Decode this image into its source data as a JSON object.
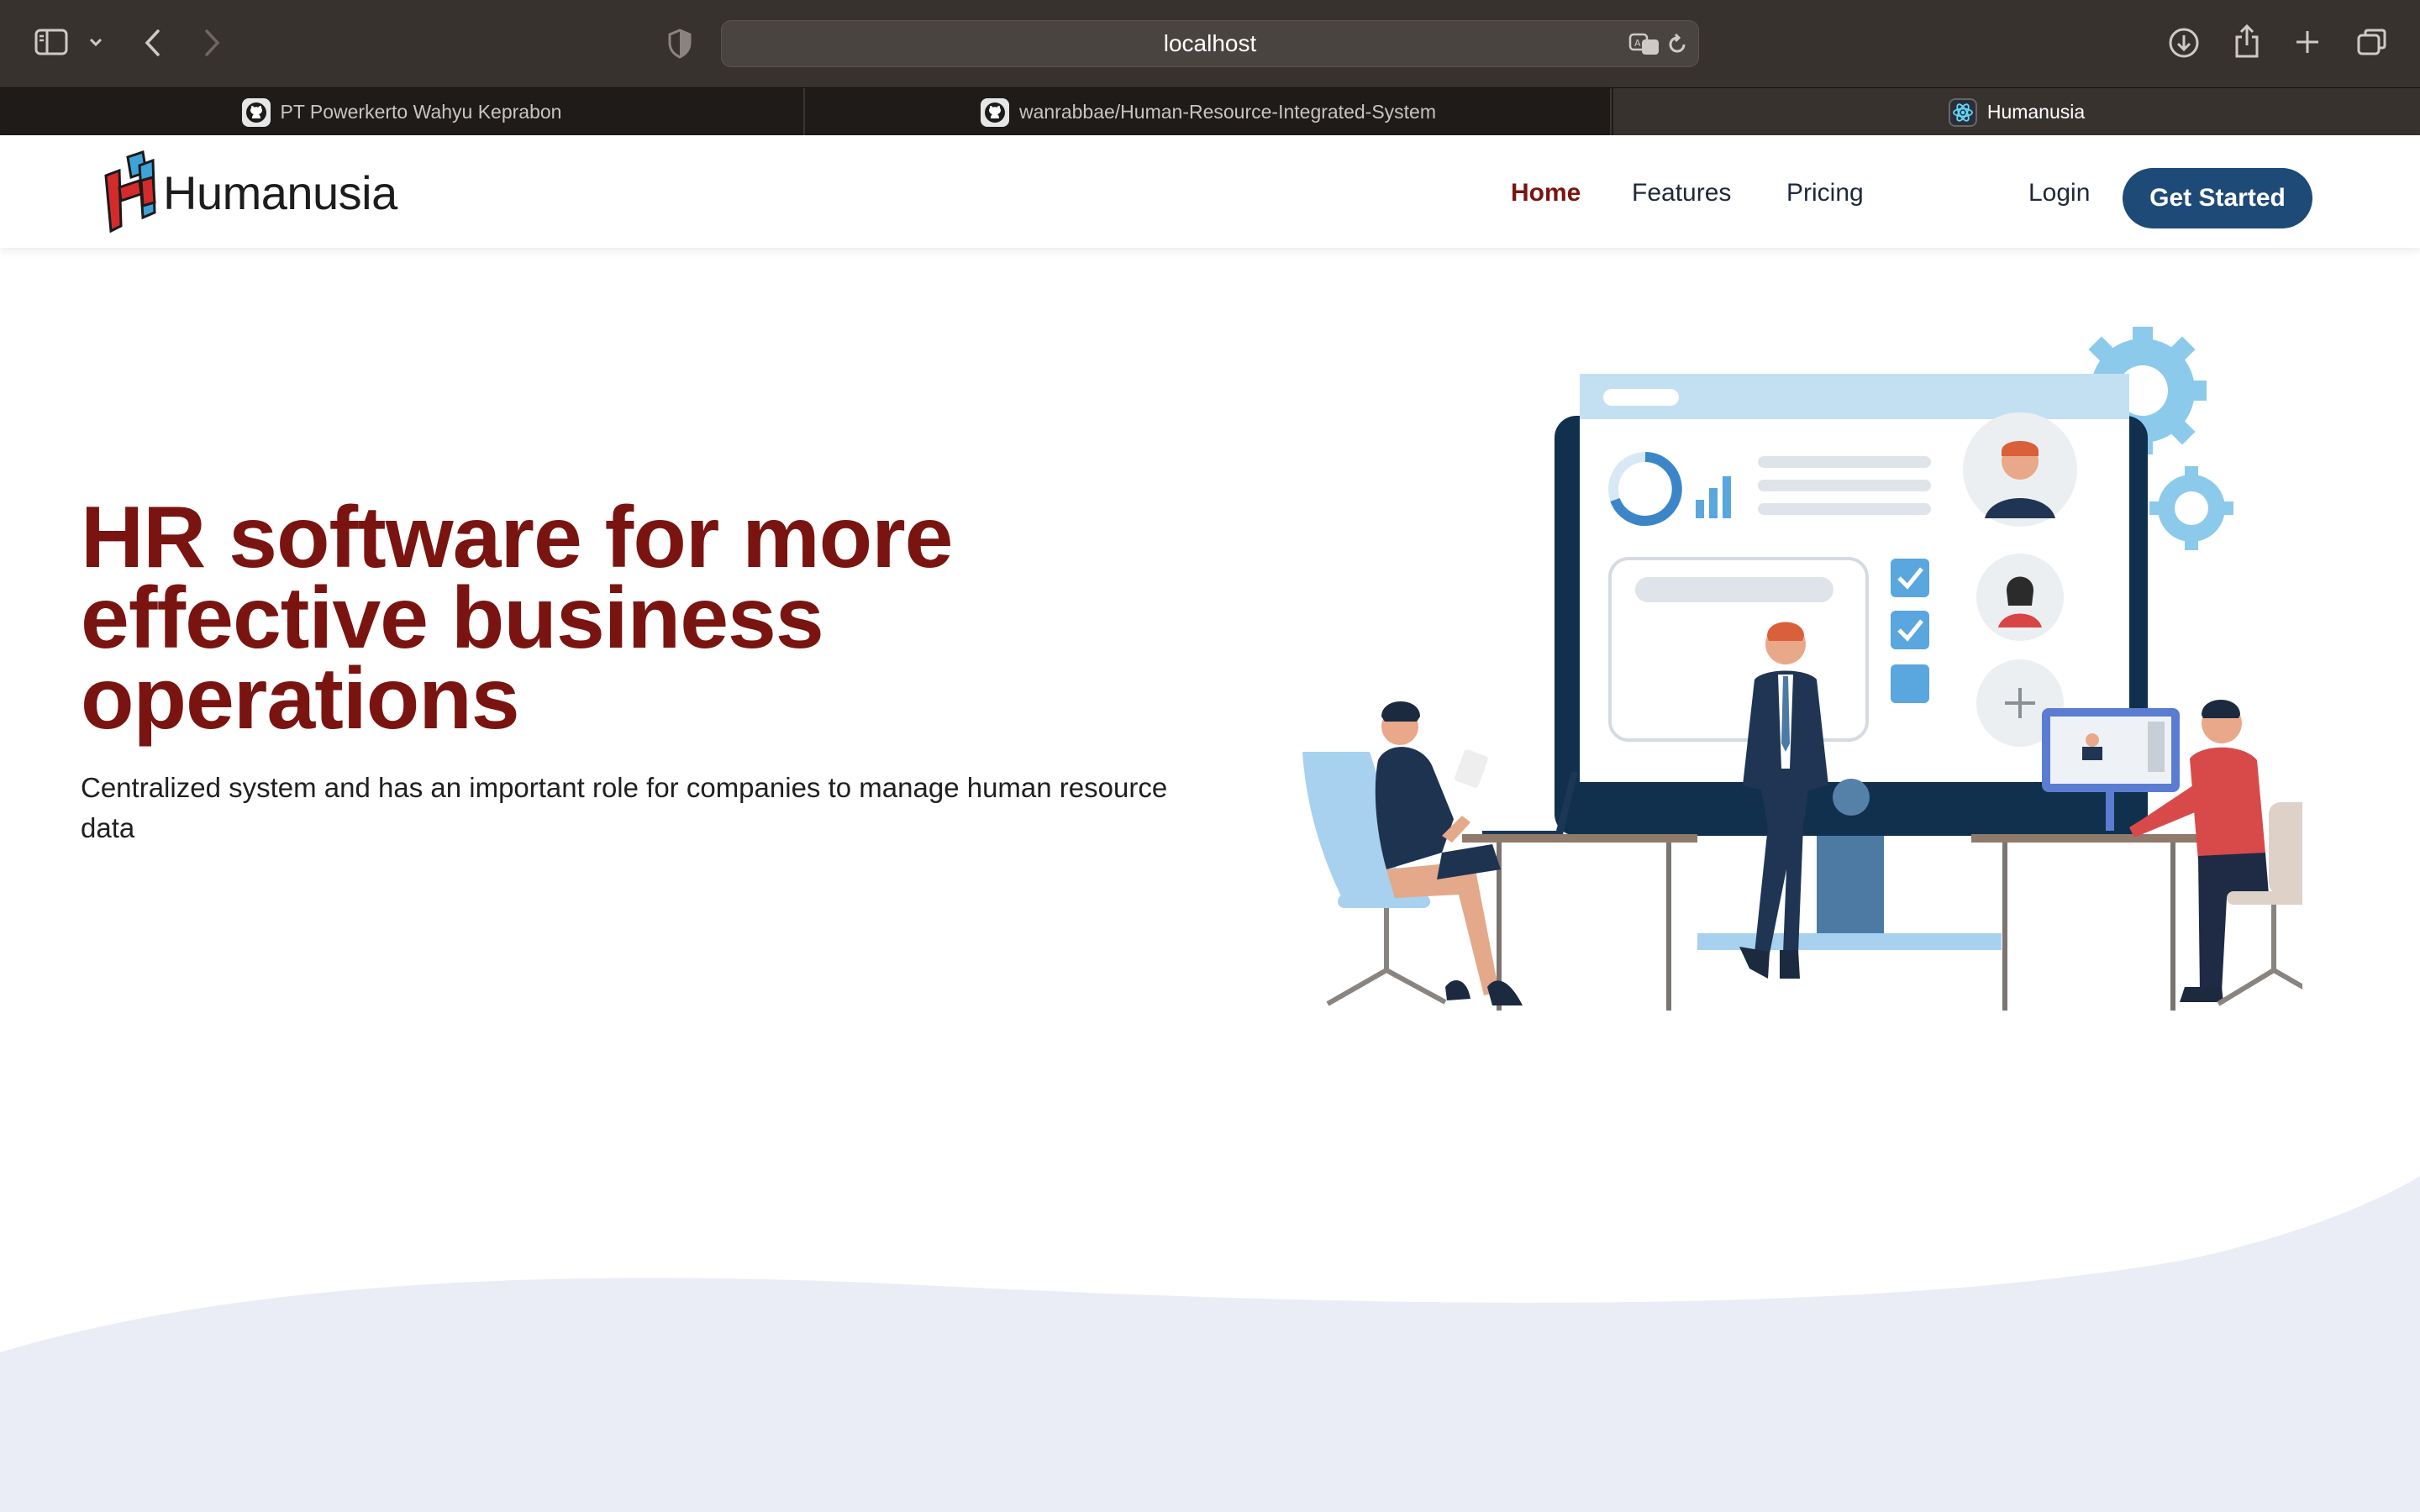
{
  "browser": {
    "url": "localhost",
    "tabs": [
      {
        "label": "PT Powerkerto Wahyu Keprabon",
        "icon": "github-icon",
        "active": false
      },
      {
        "label": "wanrabbae/Human-Resource-Integrated-System",
        "icon": "github-icon",
        "active": false
      },
      {
        "label": "Humanusia",
        "icon": "react-icon",
        "active": true
      }
    ]
  },
  "site": {
    "brand": "Humanusia",
    "nav": {
      "home": "Home",
      "features": "Features",
      "pricing": "Pricing",
      "login": "Login",
      "get_started": "Get Started"
    },
    "hero": {
      "title": "HR software for more effective business operations",
      "subtitle": "Centralized system and has an important role for companies to manage human resource data"
    }
  },
  "colors": {
    "brand_red": "#7a1410",
    "button_blue": "#1e4a78",
    "wave": "#eaedf5"
  }
}
